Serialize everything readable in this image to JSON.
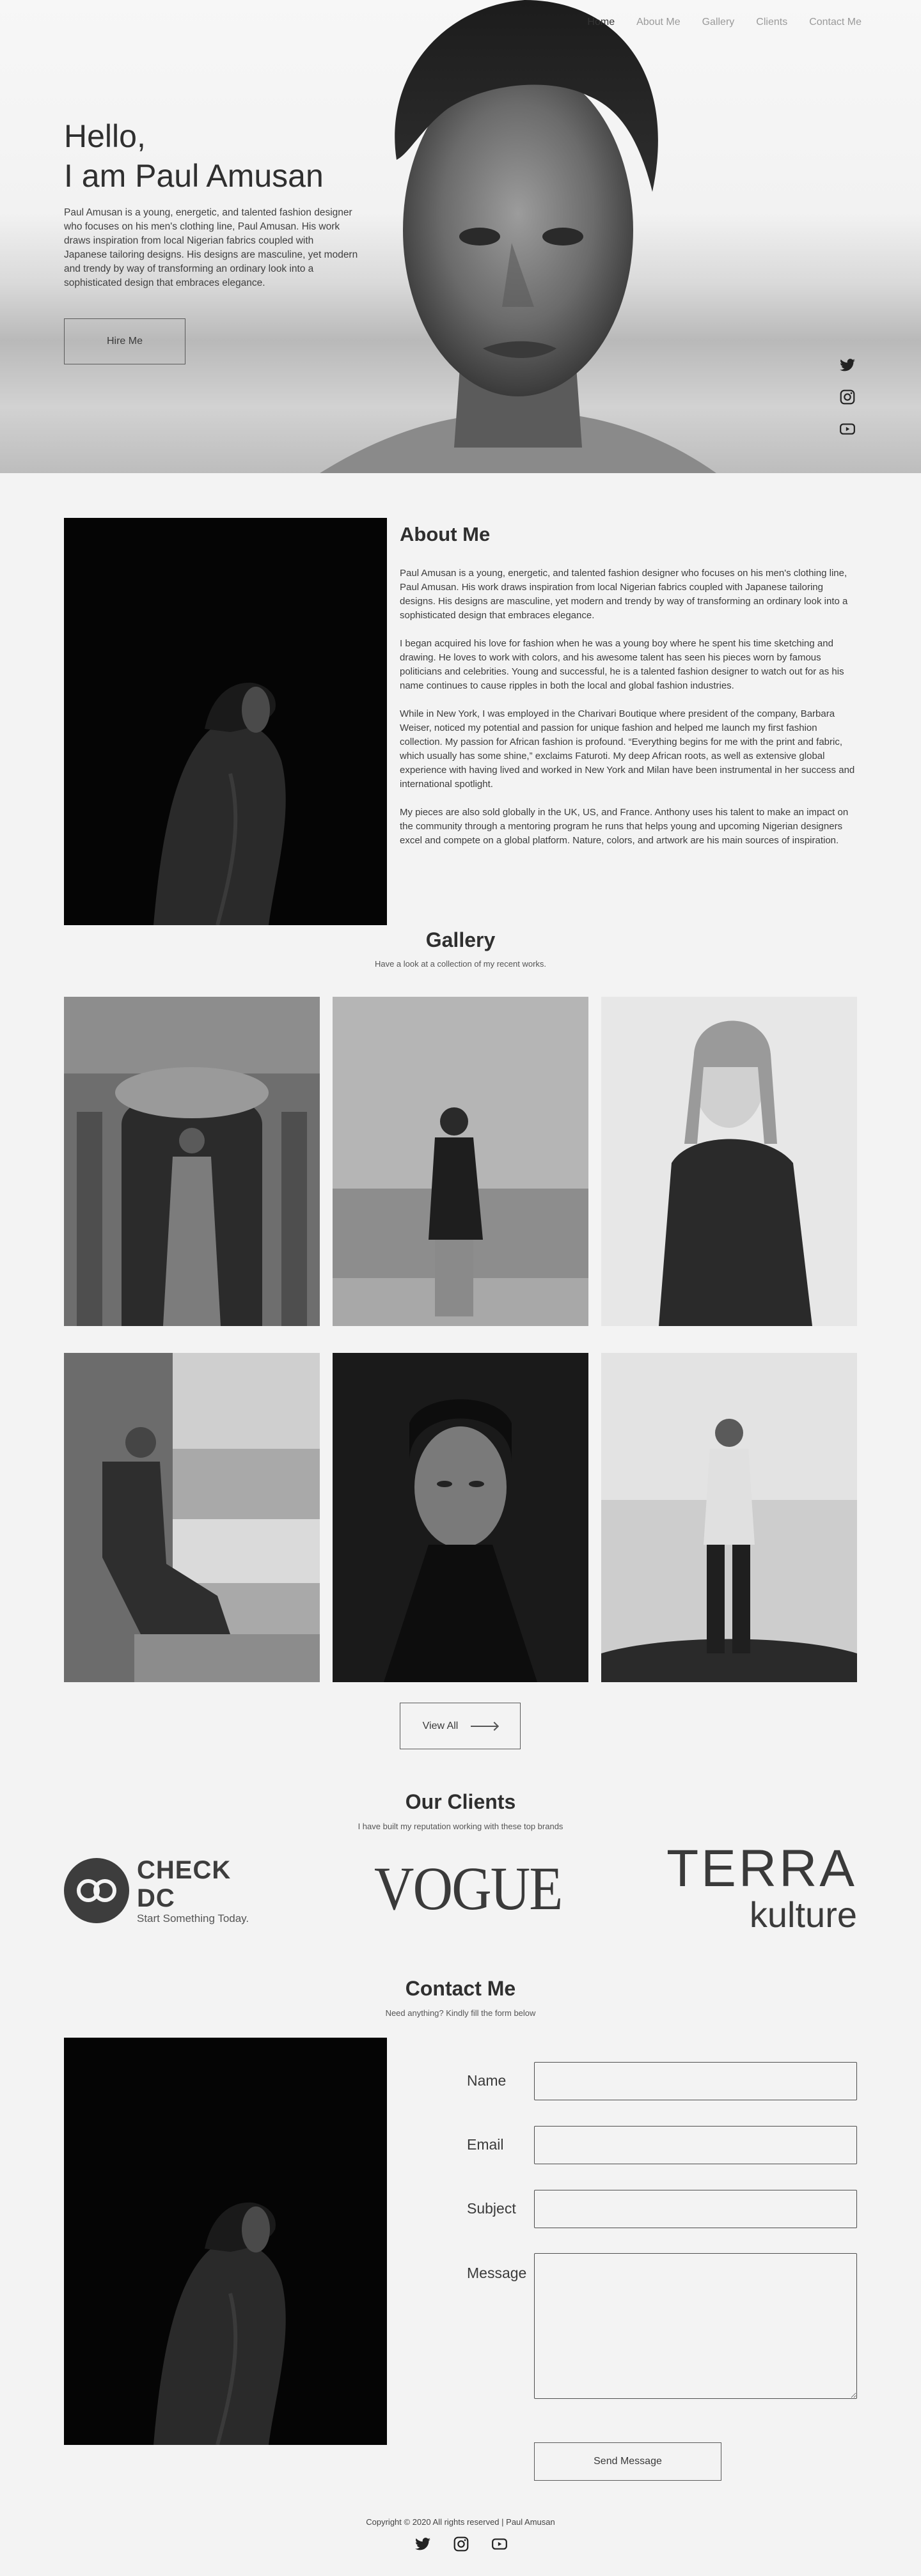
{
  "nav": {
    "items": [
      {
        "label": "Home",
        "active": true
      },
      {
        "label": "About Me",
        "active": false
      },
      {
        "label": "Gallery",
        "active": false
      },
      {
        "label": "Clients",
        "active": false
      },
      {
        "label": "Contact Me",
        "active": false
      }
    ]
  },
  "hero": {
    "greeting": "Hello,",
    "name_line": "I am Paul Amusan",
    "intro": "Paul Amusan is a young, energetic, and talented fashion designer who focuses on his men's clothing line, Paul Amusan. His work draws inspiration from local Nigerian fabrics coupled with Japanese tailoring designs. His designs are masculine, yet modern and trendy by way of transforming an ordinary look into a sophisticated design that embraces elegance.",
    "cta_label": "Hire Me",
    "social_icons": [
      "twitter-icon",
      "instagram-icon",
      "youtube-icon"
    ]
  },
  "about": {
    "title": "About Me",
    "paragraphs": [
      "Paul Amusan is a young, energetic, and talented fashion designer who focuses on his men's clothing line, Paul Amusan. His work draws inspiration from local Nigerian fabrics coupled with Japanese tailoring designs. His designs are masculine, yet modern and trendy by way of transforming an ordinary look into a sophisticated design that embraces elegance.",
      "I began acquired his love for fashion when he was a young boy where he spent his time sketching and drawing. He loves to work with colors, and his awesome talent has seen his pieces worn by famous politicians and celebrities. Young and successful, he is a talented fashion designer to watch out for as his name continues to cause ripples in both the local and global fashion industries.",
      "While in New York, I was employed in the Charivari Boutique where president of the company, Barbara Weiser, noticed my potential and passion for unique fashion and helped me launch my first fashion collection. My passion for African fashion is profound. “Everything begins for me with the print and fabric, which usually has some shine,” exclaims Faturoti. My deep African roots, as well as extensive global experience with having lived and worked in New York and Milan have been instrumental in her success and international spotlight.",
      "My pieces are also sold globally in the UK, US, and France. Anthony uses his talent to make an impact on the community through a mentoring program he runs that helps young and upcoming Nigerian designers excel and compete on a global platform. Nature, colors, and artwork are his main sources of inspiration."
    ]
  },
  "gallery": {
    "title": "Gallery",
    "subtitle": "Have a look at a collection of my recent works.",
    "view_all_label": "View All"
  },
  "clients": {
    "title": "Our Clients",
    "subtitle": "I have built my reputation working with these top brands",
    "logos": {
      "check_name": "CHECK DC",
      "check_tagline": "Start Something Today.",
      "vogue": "VOGUE",
      "terra_top": "TERRA",
      "terra_bottom": "kulture"
    }
  },
  "contact": {
    "title": "Contact Me",
    "subtitle": "Need anything? Kindly fill the form below",
    "fields": {
      "name_label": "Name",
      "email_label": "Email",
      "subject_label": "Subject",
      "message_label": "Message"
    },
    "submit_label": "Send Message"
  },
  "footer": {
    "copyright": "Copyright © 2020 All rights reserved | Paul Amusan",
    "social_icons": [
      "twitter-icon",
      "instagram-icon",
      "youtube-icon"
    ]
  }
}
